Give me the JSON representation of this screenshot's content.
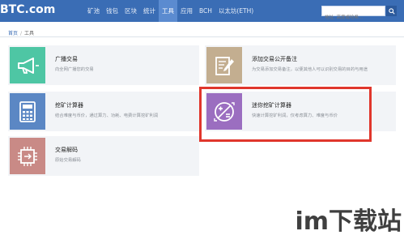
{
  "header": {
    "logo": "BTC.com",
    "nav": [
      "矿池",
      "钱包",
      "区块",
      "统计",
      "工具",
      "应用",
      "BCH",
      "以太坊(ETH)"
    ],
    "active_nav": "工具",
    "search_placeholder": "地址, 高度或哈希..."
  },
  "breadcrumb": {
    "home": "首页",
    "separator": "/",
    "current": "工具"
  },
  "tools": [
    {
      "title": "广播交易",
      "desc": "向全网广播您的交易",
      "icon": "megaphone-icon",
      "color": "#4ec6a4"
    },
    {
      "title": "添加交易公开备注",
      "desc": "为交易添加交易备注，以便其他人可以识别交易的目的与用途",
      "icon": "note-pencil-icon",
      "color": "#c3ae90"
    },
    {
      "title": "挖矿计算器",
      "desc": "结合难度与币价，通过算力、功耗、电费计算挖矿利润",
      "icon": "calculator-icon",
      "color": "#5b87c4"
    },
    {
      "title": "迷你挖矿计算器",
      "desc": "快速计算挖矿利润，仅考虑算力、难度与币价",
      "icon": "mini-calculator-icon",
      "color": "#9b6ec0"
    },
    {
      "title": "交易解码",
      "desc": "原始交易解码",
      "icon": "decode-chip-icon",
      "color": "#c98a86"
    }
  ],
  "watermark": {
    "text": "im下载站"
  }
}
